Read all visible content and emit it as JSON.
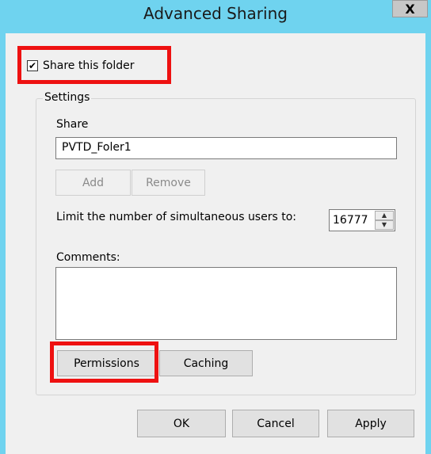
{
  "window": {
    "title": "Advanced Sharing",
    "close_glyph": "X"
  },
  "share_checkbox": {
    "label": "Share this folder",
    "checked": true,
    "check_glyph": "✔"
  },
  "settings": {
    "legend": "Settings",
    "share_label": "Share",
    "share_name": "PVTD_Foler1",
    "add_label": "Add",
    "remove_label": "Remove",
    "limit_label": "Limit the number of simultaneous users to:",
    "limit_value": "16777",
    "spin_up_glyph": "▲",
    "spin_down_glyph": "▼",
    "comments_label": "Comments:",
    "comments_value": "",
    "permissions_label": "Permissions",
    "caching_label": "Caching"
  },
  "footer": {
    "ok_label": "OK",
    "cancel_label": "Cancel",
    "apply_label": "Apply"
  },
  "colors": {
    "titlebar": "#6fd3ef",
    "highlight": "#ee1111",
    "dialog_bg": "#f0f0f0"
  }
}
